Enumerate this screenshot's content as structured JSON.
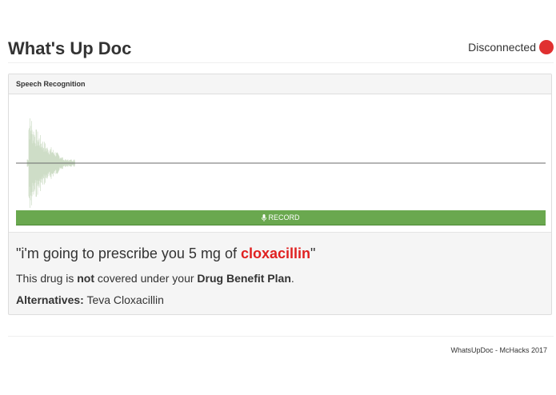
{
  "header": {
    "title": "What's Up Doc",
    "status_text": "Disconnected",
    "status_color": "#e03030"
  },
  "panel": {
    "heading": "Speech Recognition",
    "record_label": "RECORD",
    "record_icon": "microphone-icon",
    "accent_color": "#6aa84f",
    "waveform_color": "#c5d7bd"
  },
  "result": {
    "quote_prefix": "\"i'm going to prescribe you 5 mg of ",
    "drug_name": "cloxacillin",
    "quote_suffix": "\"",
    "coverage_prefix": "This drug is ",
    "coverage_not": "not",
    "coverage_middle": " covered under your ",
    "coverage_plan": "Drug Benefit Plan",
    "coverage_suffix": ".",
    "alternatives_label": "Alternatives:",
    "alternatives_value": " Teva Cloxacillin"
  },
  "footer": {
    "text": "WhatsUpDoc - McHacks 2017"
  }
}
